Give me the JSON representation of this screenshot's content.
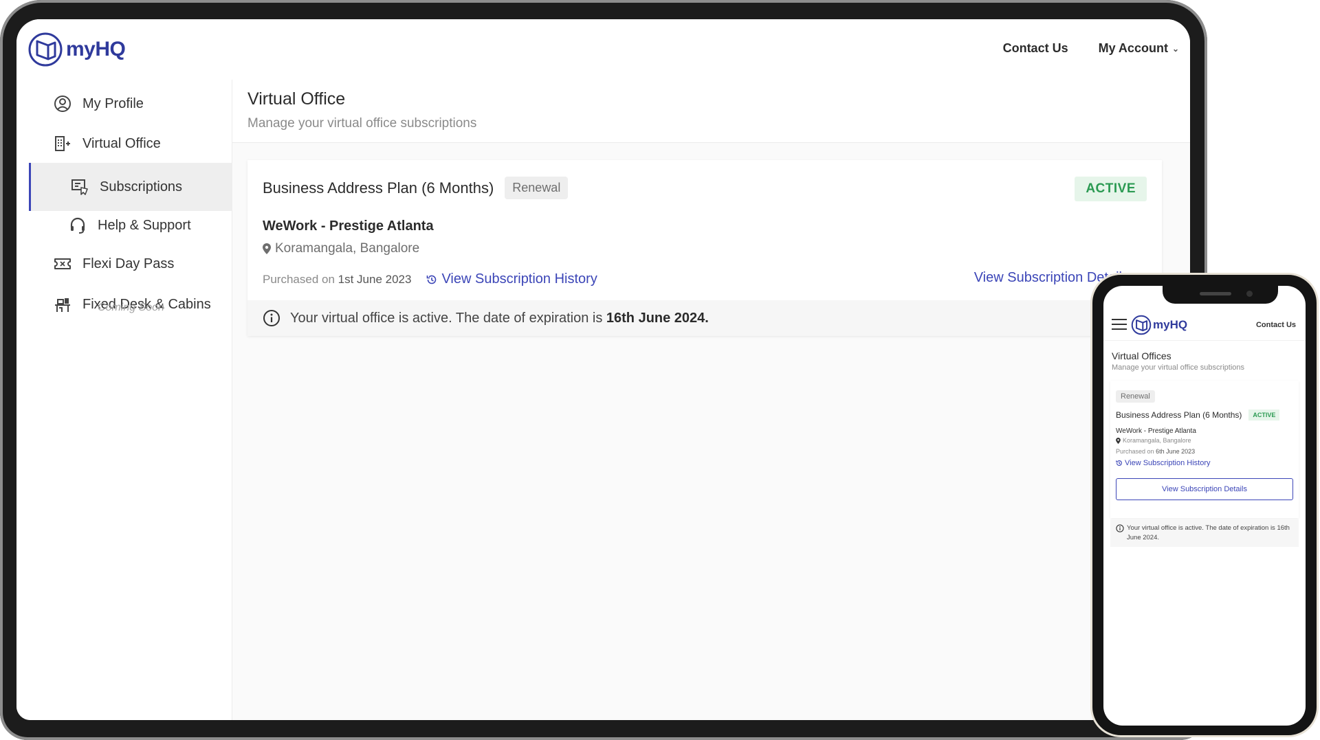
{
  "brand": {
    "name": "myHQ",
    "color": "#2f3a9c"
  },
  "header": {
    "contact": "Contact Us",
    "account": "My Account"
  },
  "sidebar": {
    "items": [
      {
        "label": "My Profile",
        "icon": "user-circle-icon"
      },
      {
        "label": "Virtual Office",
        "icon": "building-icon"
      },
      {
        "label": "Subscriptions",
        "icon": "subscription-icon",
        "active": true
      },
      {
        "label": "Help & Support",
        "icon": "headset-icon"
      },
      {
        "label": "Flexi Day Pass",
        "icon": "ticket-icon"
      },
      {
        "label": "Fixed Desk & Cabins",
        "icon": "desk-icon",
        "note": "Coming Soon"
      }
    ]
  },
  "main": {
    "title": "Virtual Office",
    "subtitle": "Manage your virtual office subscriptions",
    "card": {
      "plan": "Business Address Plan (6 Months)",
      "type_badge": "Renewal",
      "status": "ACTIVE",
      "venue": "WeWork - Prestige Atlanta",
      "locality": "Koramangala, Bangalore",
      "purchased_label": "Purchased on",
      "purchased_date": "1st June 2023",
      "history_link": "View Subscription History",
      "details_link": "View Subscription Details",
      "notice_text": "Your virtual office is active. The date of expiration is",
      "notice_date": "16th June 2024."
    }
  },
  "mobile": {
    "contact": "Contact Us",
    "title": "Virtual Offices",
    "subtitle": "Manage your virtual office subscriptions",
    "type_badge": "Renewal",
    "plan": "Business Address Plan (6 Months)",
    "status": "ACTIVE",
    "venue": "WeWork - Prestige Atlanta",
    "locality": "Koramangala, Bangalore",
    "purchased_label": "Purchased on",
    "purchased_date": "6th June 2023",
    "history_link": "View Subscription History",
    "details_button": "View Subscription Details",
    "notice": "Your virtual office is active. The date of expiration is 16th June 2024."
  },
  "colors": {
    "accent": "#3b45b7",
    "active_text": "#2b9a52",
    "active_bg": "#e6f5ea"
  }
}
